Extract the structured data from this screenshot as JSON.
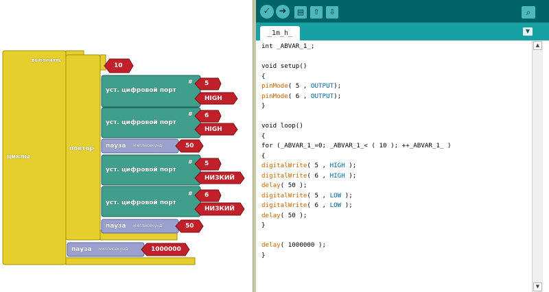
{
  "blocks": {
    "loop_block": {
      "title": "выполнять",
      "label": "циклы"
    },
    "repeat_block": {
      "label": "повтор",
      "count": "10"
    },
    "digital_writes": [
      {
        "label": "уст. цифровой порт",
        "hash": "#",
        "pin": "5",
        "state": "HIGH"
      },
      {
        "label": "уст. цифровой порт",
        "hash": "#",
        "pin": "6",
        "state": "HIGH"
      },
      {
        "label": "уст. цифровой порт",
        "hash": "#",
        "pin": "5",
        "state": "НИЗКИЙ"
      },
      {
        "label": "уст. цифровой порт",
        "hash": "#",
        "pin": "6",
        "state": "НИЗКИЙ"
      }
    ],
    "delays": [
      {
        "label": "пауза",
        "unit": "миллисекунд",
        "value": "50"
      },
      {
        "label": "пауза",
        "unit": "миллисекунд",
        "value": "50"
      },
      {
        "label": "пауза",
        "unit": "миллисекунд",
        "value": "1000000"
      }
    ]
  },
  "ide": {
    "toolbar": {
      "verify_icon": "checkmark-icon",
      "upload_icon": "arrow-right-icon",
      "new_icon": "new-file-icon",
      "open_icon": "open-file-icon",
      "save_icon": "save-file-icon",
      "serial_icon": "magnifier-icon"
    },
    "tab_label": "_1m_h_",
    "code_lines": [
      [
        {
          "t": "int _ABVAR_1_;",
          "c": ""
        }
      ],
      [],
      [
        {
          "t": "void setup()",
          "c": ""
        }
      ],
      [
        {
          "t": "{",
          "c": ""
        }
      ],
      [
        {
          "t": "pinMode",
          "c": "kw"
        },
        {
          "t": "( 5 , ",
          "c": ""
        },
        {
          "t": "OUTPUT",
          "c": "cst"
        },
        {
          "t": ");",
          "c": ""
        }
      ],
      [
        {
          "t": "pinMode",
          "c": "kw"
        },
        {
          "t": "( 6 , ",
          "c": ""
        },
        {
          "t": "OUTPUT",
          "c": "cst"
        },
        {
          "t": ");",
          "c": ""
        }
      ],
      [
        {
          "t": "}",
          "c": ""
        }
      ],
      [],
      [
        {
          "t": "void loop()",
          "c": ""
        }
      ],
      [
        {
          "t": "{",
          "c": ""
        }
      ],
      [
        {
          "t": "for (_ABVAR_1_=0; _ABVAR_1_< ( 10 ); ++_ABVAR_1_ )",
          "c": ""
        }
      ],
      [
        {
          "t": "{",
          "c": ""
        }
      ],
      [
        {
          "t": "digitalWrite",
          "c": "kw"
        },
        {
          "t": "( 5 , ",
          "c": ""
        },
        {
          "t": "HIGH",
          "c": "cst"
        },
        {
          "t": " );",
          "c": ""
        }
      ],
      [
        {
          "t": "digitalWrite",
          "c": "kw"
        },
        {
          "t": "( 6 , ",
          "c": ""
        },
        {
          "t": "HIGH",
          "c": "cst"
        },
        {
          "t": " );",
          "c": ""
        }
      ],
      [
        {
          "t": "delay",
          "c": "kw"
        },
        {
          "t": "( 50 );",
          "c": ""
        }
      ],
      [
        {
          "t": "digitalWrite",
          "c": "kw"
        },
        {
          "t": "( 5 , ",
          "c": ""
        },
        {
          "t": "LOW",
          "c": "cst"
        },
        {
          "t": " );",
          "c": ""
        }
      ],
      [
        {
          "t": "digitalWrite",
          "c": "kw"
        },
        {
          "t": "( 6 , ",
          "c": ""
        },
        {
          "t": "LOW",
          "c": "cst"
        },
        {
          "t": " );",
          "c": ""
        }
      ],
      [
        {
          "t": "delay",
          "c": "kw"
        },
        {
          "t": "( 50 );",
          "c": ""
        }
      ],
      [
        {
          "t": "}",
          "c": ""
        }
      ],
      [],
      [
        {
          "t": "delay",
          "c": "kw"
        },
        {
          "t": "( 1000000 );",
          "c": ""
        }
      ],
      [
        {
          "t": "}",
          "c": ""
        }
      ]
    ]
  },
  "colors": {
    "loop_yellow": "#e6cf2c",
    "digital_teal": "#3f9e8c",
    "delay_lavender": "#9ba1cf",
    "value_red": "#c0202a",
    "ide_toolbar": "#006468",
    "ide_tabbar": "#17a1a5"
  }
}
